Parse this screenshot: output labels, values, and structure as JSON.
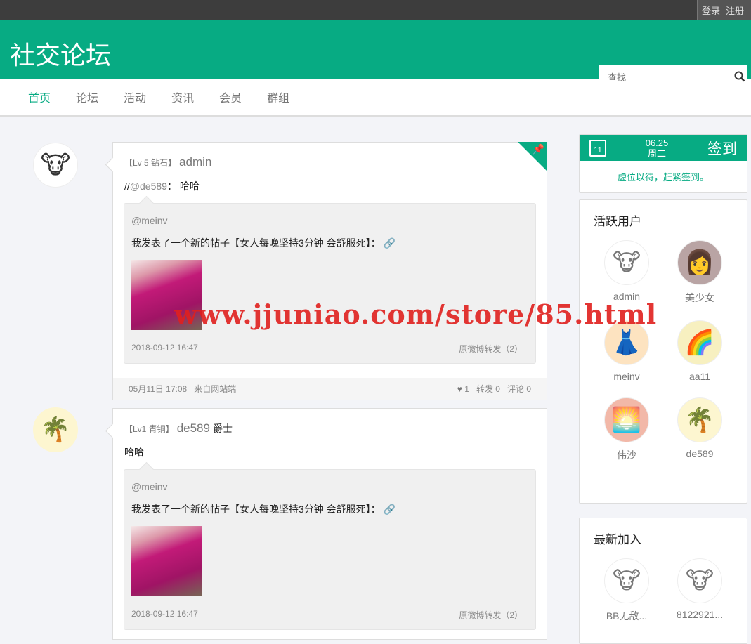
{
  "topbar": {
    "login": "登录",
    "register": "注册"
  },
  "header": {
    "logo": "社交论坛",
    "search_placeholder": "查找"
  },
  "nav": [
    "首页",
    "论坛",
    "活动",
    "资讯",
    "会员",
    "群组"
  ],
  "posts": [
    {
      "level": "【Lv 5 钻石】",
      "name": "admin",
      "title": "",
      "content_prefix": "//",
      "content_mention": "@de589",
      "content_text": "：  哈哈",
      "quote_at": "@meinv",
      "quote_text": "我发表了一个新的帖子【女人每晚坚持3分钟 会舒服死】：",
      "quote_date": "2018-09-12 16:47",
      "quote_forward": "原微博转发（2）",
      "date": "05月11日 17:08",
      "source": "来自网站端",
      "likes": "1",
      "forwards": "转发 0",
      "comments": "评论 0"
    },
    {
      "level": "【Lv1 青铜】",
      "name": "de589",
      "title": "爵士",
      "content_text": "哈哈",
      "quote_at": "@meinv",
      "quote_text": "我发表了一个新的帖子【女人每晚坚持3分钟 会舒服死】：",
      "quote_date": "2018-09-12 16:47",
      "quote_forward": "原微博转发（2）"
    }
  ],
  "sign": {
    "day": "11",
    "date": "06.25",
    "weekday": "周二",
    "button": "签到",
    "message": "虚位以待，赶紧签到。"
  },
  "active_users": {
    "title": "活跃用户",
    "users": [
      "admin",
      "美少女",
      "meinv",
      "aa11",
      "伟沙",
      "de589"
    ]
  },
  "new_users": {
    "title": "最新加入",
    "users": [
      "BB无敌...",
      "8122921..."
    ]
  },
  "watermark": "www.jjuniao.com/store/85.html"
}
